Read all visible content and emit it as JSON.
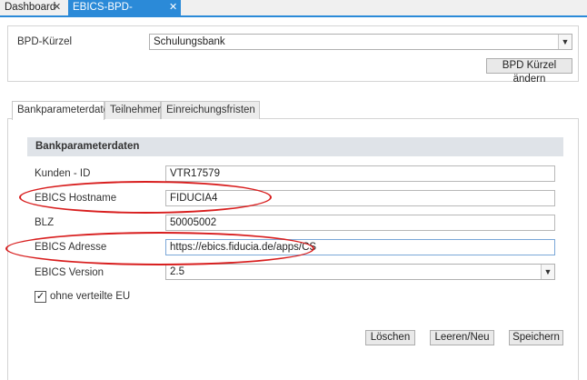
{
  "tabs": [
    {
      "label": "Dashboard",
      "close": "✕",
      "active": false
    },
    {
      "label": "EBICS-BPD-Verwaltung",
      "close": "✕",
      "active": true
    }
  ],
  "bpd": {
    "label": "BPD-Kürzel",
    "value": "Schulungsbank",
    "change_button": "BPD Kürzel ändern"
  },
  "content_tabs": [
    "Bankparameterdaten",
    "Teilnehmer",
    "Einreichungsfristen"
  ],
  "section": {
    "title": "Bankparameterdaten",
    "fields": [
      {
        "label": "Kunden - ID",
        "value": "VTR17579"
      },
      {
        "label": "EBICS Hostname",
        "value": "FIDUCIA4"
      },
      {
        "label": "BLZ",
        "value": "50005002"
      },
      {
        "label": "EBICS Adresse",
        "value": "https://ebics.fiducia.de/apps/CS"
      },
      {
        "label": "EBICS Version",
        "value": "2.5"
      }
    ],
    "checkbox": {
      "label": "ohne verteilte EU",
      "checked": true,
      "mark": "✓"
    }
  },
  "buttons": {
    "delete": "Löschen",
    "clear": "Leeren/Neu",
    "save": "Speichern"
  },
  "icons": {
    "dropdown": "chevron-down-icon",
    "close": "close-icon",
    "check": "check-icon"
  },
  "colors": {
    "accent": "#2b8ad8",
    "annotation": "#d81e1e",
    "section_bg": "#dfe3e8"
  }
}
